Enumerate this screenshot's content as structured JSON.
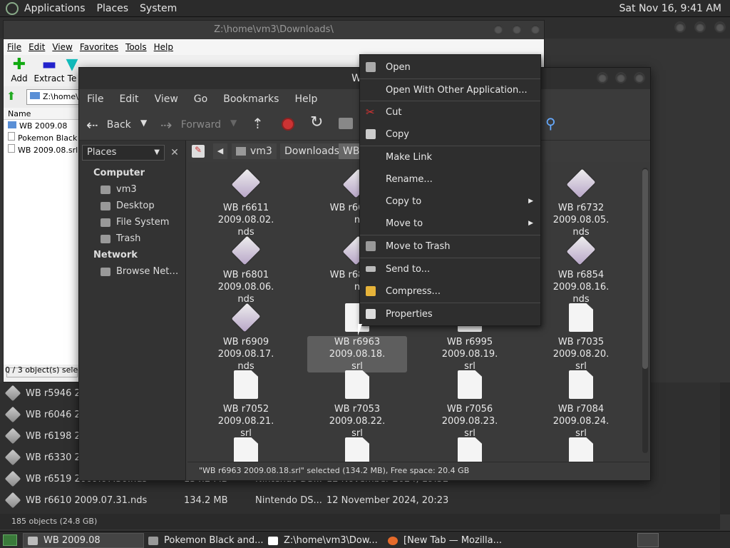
{
  "top_panel": {
    "menus": [
      "Applications",
      "Places",
      "System"
    ],
    "clock": "Sat Nov 16,  9:41 AM"
  },
  "archive_window": {
    "title": "Z:\\home\\vm3\\Downloads\\",
    "menu": [
      "File",
      "Edit",
      "View",
      "Favorites",
      "Tools",
      "Help"
    ],
    "tools": [
      "Add",
      "Extract",
      "Te"
    ],
    "path": "Z:\\home\\",
    "column": "Name",
    "items": [
      "WB 2009.08",
      "Pokemon Black an",
      "WB 2009.08.srl"
    ],
    "status": "0 / 3 object(s) selecte"
  },
  "bg_list": {
    "rows": [
      {
        "name": "WB r5946 20",
        "size": "",
        "type": "",
        "date": ""
      },
      {
        "name": "WB r6046 20",
        "size": "",
        "type": "",
        "date": ""
      },
      {
        "name": "WB r6198 20",
        "size": "",
        "type": "",
        "date": ""
      },
      {
        "name": "WB r6330 20",
        "size": "",
        "type": "",
        "date": ""
      },
      {
        "name": "WB r6519 2009.07.30.nds",
        "size": "134.2 MB",
        "type": "Nintendo DS...",
        "date": "12 November 2024, 19:52"
      },
      {
        "name": "WB r6610 2009.07.31.nds",
        "size": "134.2 MB",
        "type": "Nintendo DS...",
        "date": "12 November 2024, 20:23"
      }
    ],
    "status": "185 objects (24.8 GB)"
  },
  "nautilus": {
    "title": "WB 2",
    "menu": [
      "File",
      "Edit",
      "View",
      "Go",
      "Bookmarks",
      "Help"
    ],
    "toolbar": {
      "back": "Back",
      "forward": "Forward"
    },
    "sidebar": {
      "combo": "Places",
      "sections": [
        {
          "heading": "Computer",
          "items": [
            "vm3",
            "Desktop",
            "File System",
            "Trash"
          ]
        },
        {
          "heading": "Network",
          "items": [
            "Browse Net…"
          ]
        }
      ]
    },
    "location": [
      "vm3",
      "Downloads",
      "WB"
    ],
    "files": [
      {
        "line1": "WB r6611 2009.08.02.",
        "line2": "nds",
        "kind": "nds"
      },
      {
        "line1": "WB r6642 2",
        "line2": "n",
        "kind": "nds"
      },
      {
        "line1": "",
        "line2": "",
        "kind": "none"
      },
      {
        "line1": "WB r6732 2009.08.05.",
        "line2": "nds",
        "kind": "nds"
      },
      {
        "line1": "WB r6801 2009.08.06.",
        "line2": "nds",
        "kind": "nds"
      },
      {
        "line1": "WB r6845 2",
        "line2": "n",
        "kind": "nds"
      },
      {
        "line1": "",
        "line2": "",
        "kind": "none"
      },
      {
        "line1": "WB r6854 2009.08.16.",
        "line2": "nds",
        "kind": "nds"
      },
      {
        "line1": "WB r6909 2009.08.17.",
        "line2": "nds",
        "kind": "nds"
      },
      {
        "line1": "WB r6963 2009.08.18.",
        "line2": "srl",
        "kind": "srl"
      },
      {
        "line1": "WB r6995 2009.08.19.",
        "line2": "srl",
        "kind": "srl"
      },
      {
        "line1": "WB r7035 2009.08.20.",
        "line2": "srl",
        "kind": "srl"
      },
      {
        "line1": "WB r7052 2009.08.21.",
        "line2": "srl",
        "kind": "srl"
      },
      {
        "line1": "WB r7053 2009.08.22.",
        "line2": "srl",
        "kind": "srl"
      },
      {
        "line1": "WB r7056 2009.08.23.",
        "line2": "srl",
        "kind": "srl"
      },
      {
        "line1": "WB r7084 2009.08.24.",
        "line2": "srl",
        "kind": "srl"
      },
      {
        "line1": "",
        "line2": "",
        "kind": "srl"
      },
      {
        "line1": "",
        "line2": "",
        "kind": "srl"
      },
      {
        "line1": "",
        "line2": "",
        "kind": "srl"
      },
      {
        "line1": "",
        "line2": "",
        "kind": "srl"
      }
    ],
    "status": "\"WB r6963 2009.08.18.srl\" selected (134.2 MB), Free space: 20.4 GB"
  },
  "context_menu": {
    "items": [
      "Open",
      "Open With Other Application...",
      "Cut",
      "Copy",
      "Make Link",
      "Rename...",
      "Copy to",
      "Move to",
      "Move to Trash",
      "Send to...",
      "Compress...",
      "Properties"
    ]
  },
  "taskbar": {
    "tasks": [
      "WB 2009.08",
      "Pokemon Black and...",
      "Z:\\home\\vm3\\Dow...",
      "[New Tab — Mozilla..."
    ]
  }
}
